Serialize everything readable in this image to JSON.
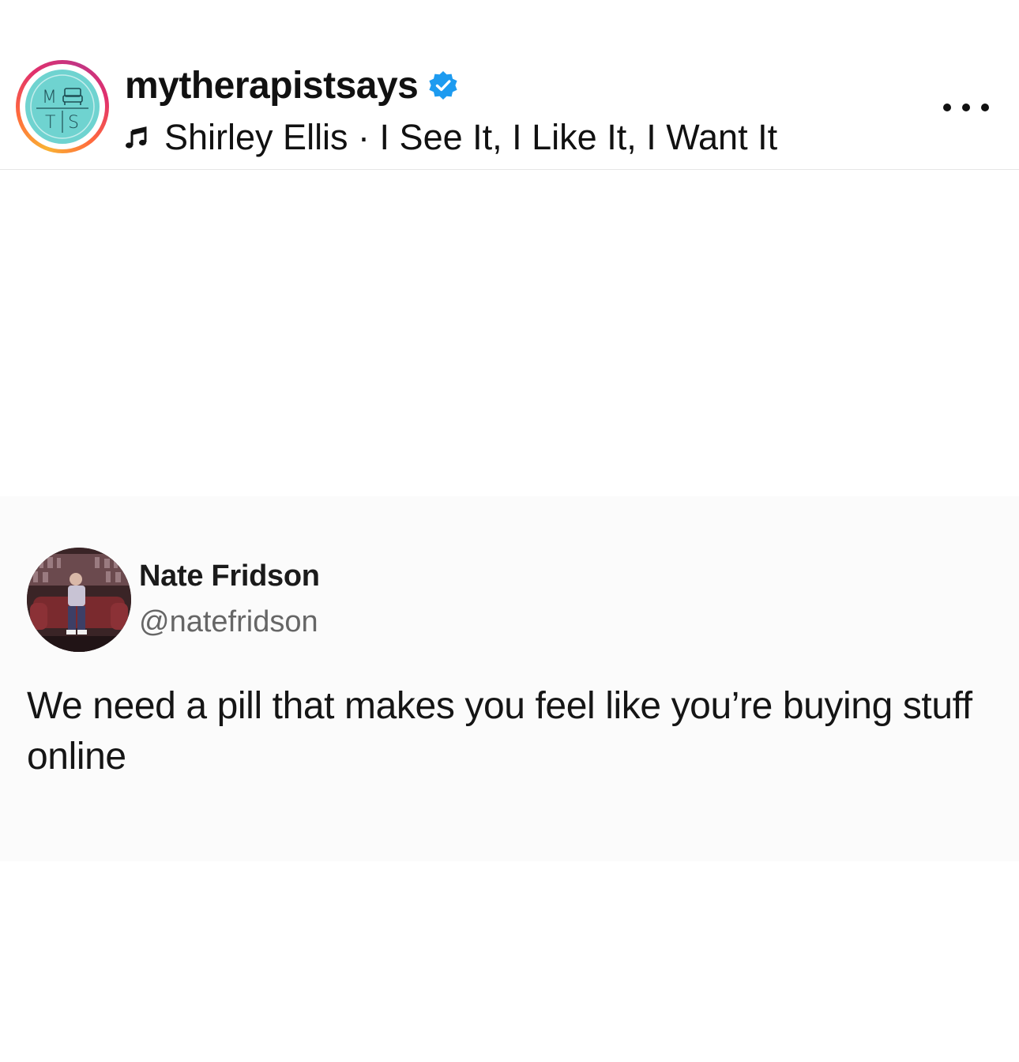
{
  "post": {
    "username": "mytherapistsays",
    "verified": true,
    "avatar_initials": [
      "M",
      "T",
      "S"
    ],
    "audio": "Shirley Ellis · I See It, I Like It, I Want It",
    "audio_icon": "music-note-icon",
    "more_icon": "more-options-icon"
  },
  "tweet": {
    "display_name": "Nate Fridson",
    "handle": "@natefridson",
    "text": "We need a pill that makes you feel like you’re buying stuff online"
  },
  "colors": {
    "verified_blue": "#1d9bf0",
    "avatar_teal": "#6fd3d0",
    "ring_gradient": [
      "#f9b233",
      "#ff6a3d",
      "#e1306c",
      "#c13584"
    ]
  }
}
